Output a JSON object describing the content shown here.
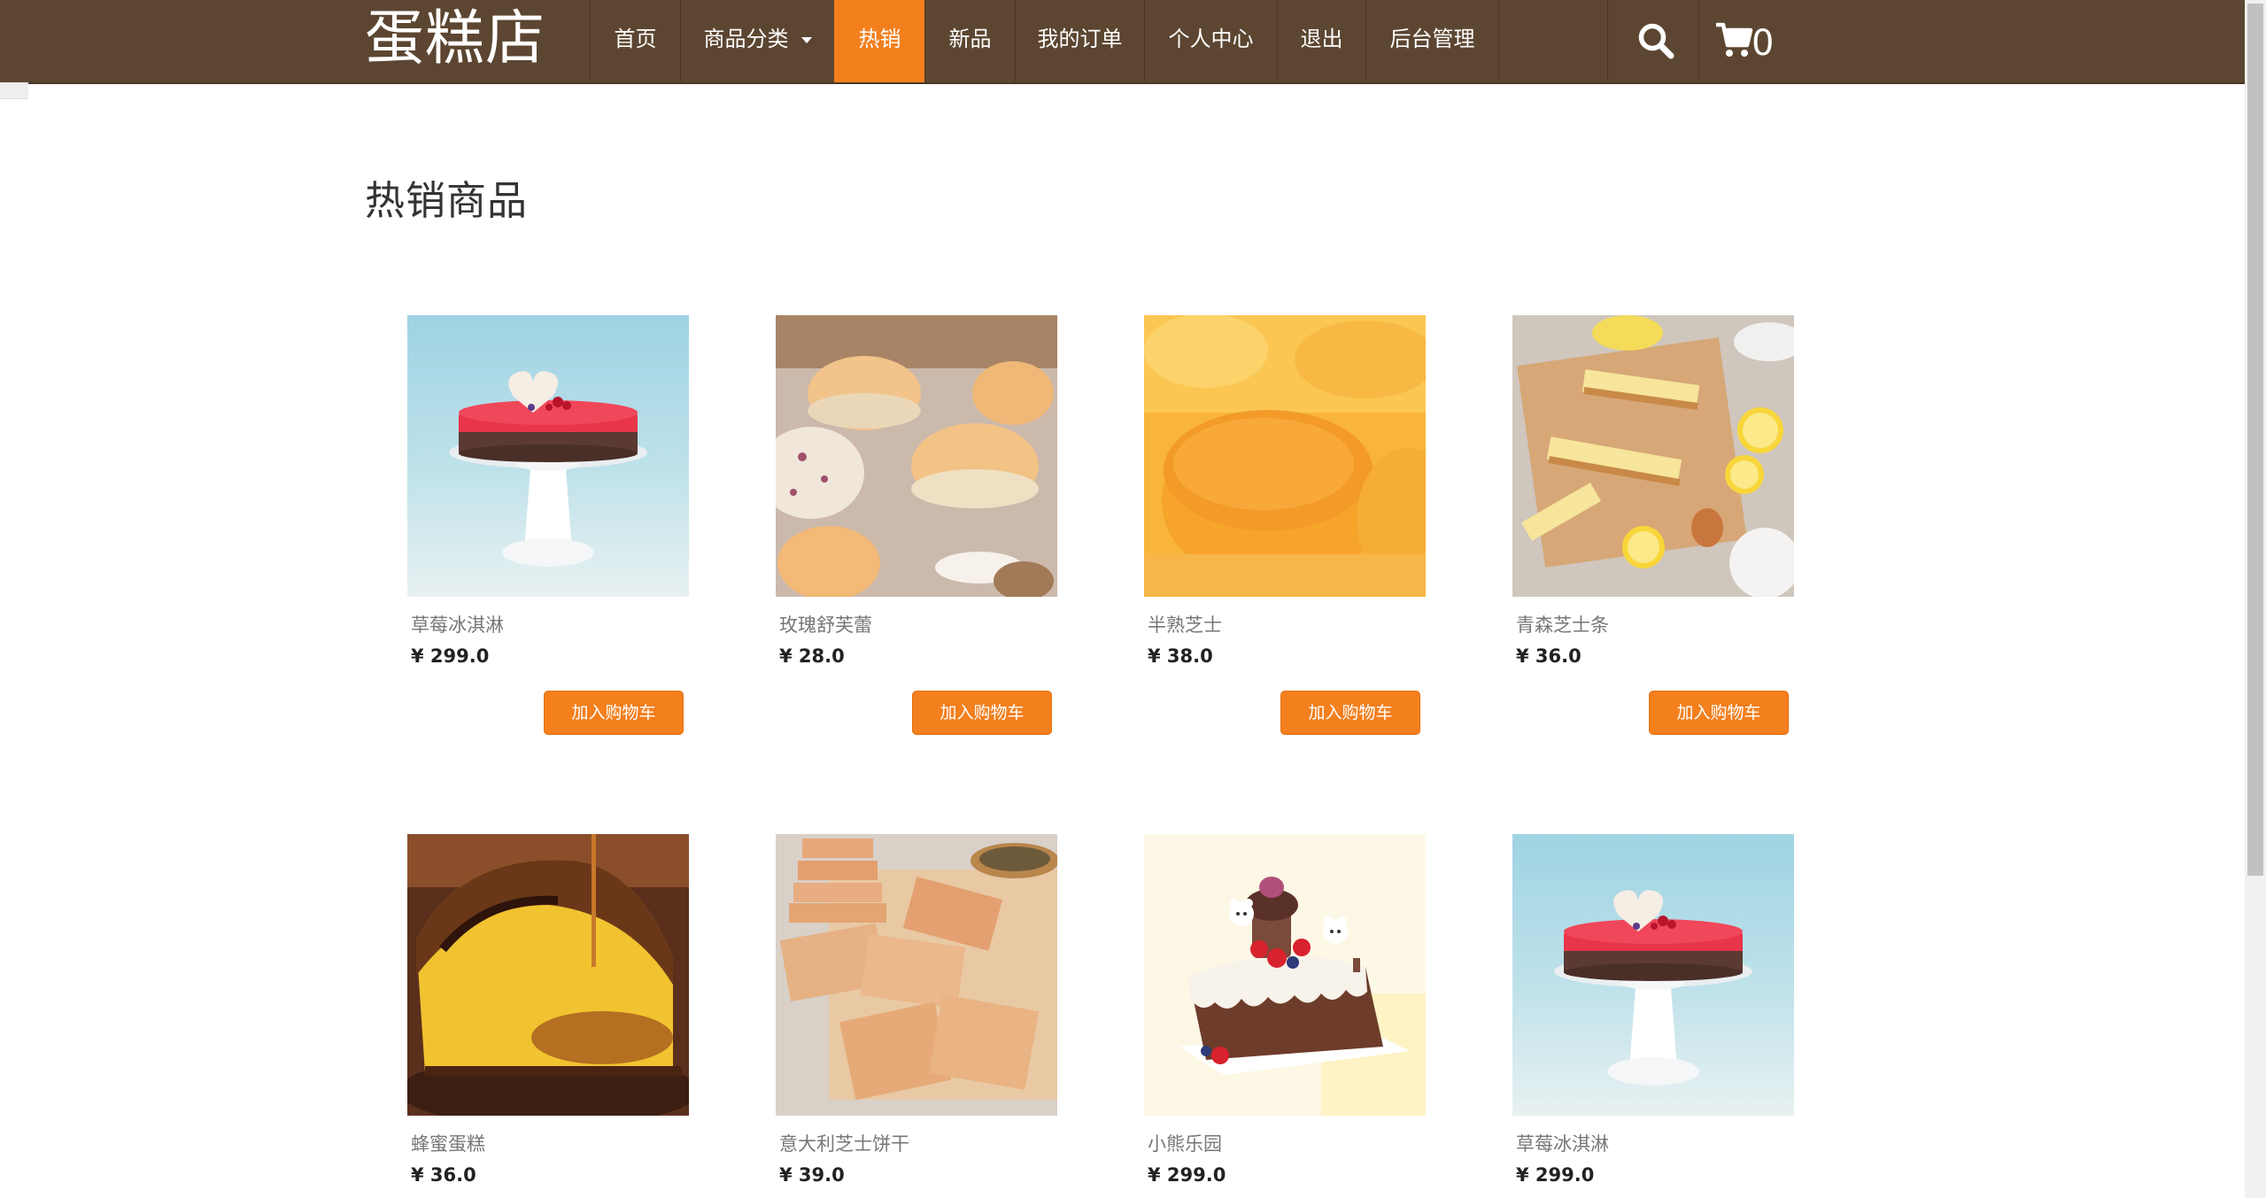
{
  "brand": "蛋糕店",
  "nav": {
    "home": "首页",
    "categories": "商品分类",
    "hot": "热销",
    "new": "新品",
    "orders": "我的订单",
    "profile": "个人中心",
    "logout": "退出",
    "admin": "后台管理",
    "cart_count": "0",
    "active_item": "热销"
  },
  "icons": {
    "search": "search-icon",
    "cart": "cart-icon",
    "dropdown": "caret-down-icon"
  },
  "colors": {
    "navbar": "#5c4631",
    "accent": "#f47f1d"
  },
  "page_title": "热销商品",
  "products": [
    {
      "name": "草莓冰淇淋",
      "price": "¥ 299.0",
      "button": "加入购物车"
    },
    {
      "name": "玫瑰舒芙蕾",
      "price": "¥ 28.0",
      "button": "加入购物车"
    },
    {
      "name": "半熟芝士",
      "price": "¥ 38.0",
      "button": "加入购物车"
    },
    {
      "name": "青森芝士条",
      "price": "¥ 36.0",
      "button": "加入购物车"
    },
    {
      "name": "蜂蜜蛋糕",
      "price": "¥ 36.0"
    },
    {
      "name": "意大利芝士饼干",
      "price": "¥ 39.0"
    },
    {
      "name": "小熊乐园",
      "price": "¥ 299.0"
    },
    {
      "name": "草莓冰淇淋",
      "price": "¥ 299.0"
    }
  ]
}
